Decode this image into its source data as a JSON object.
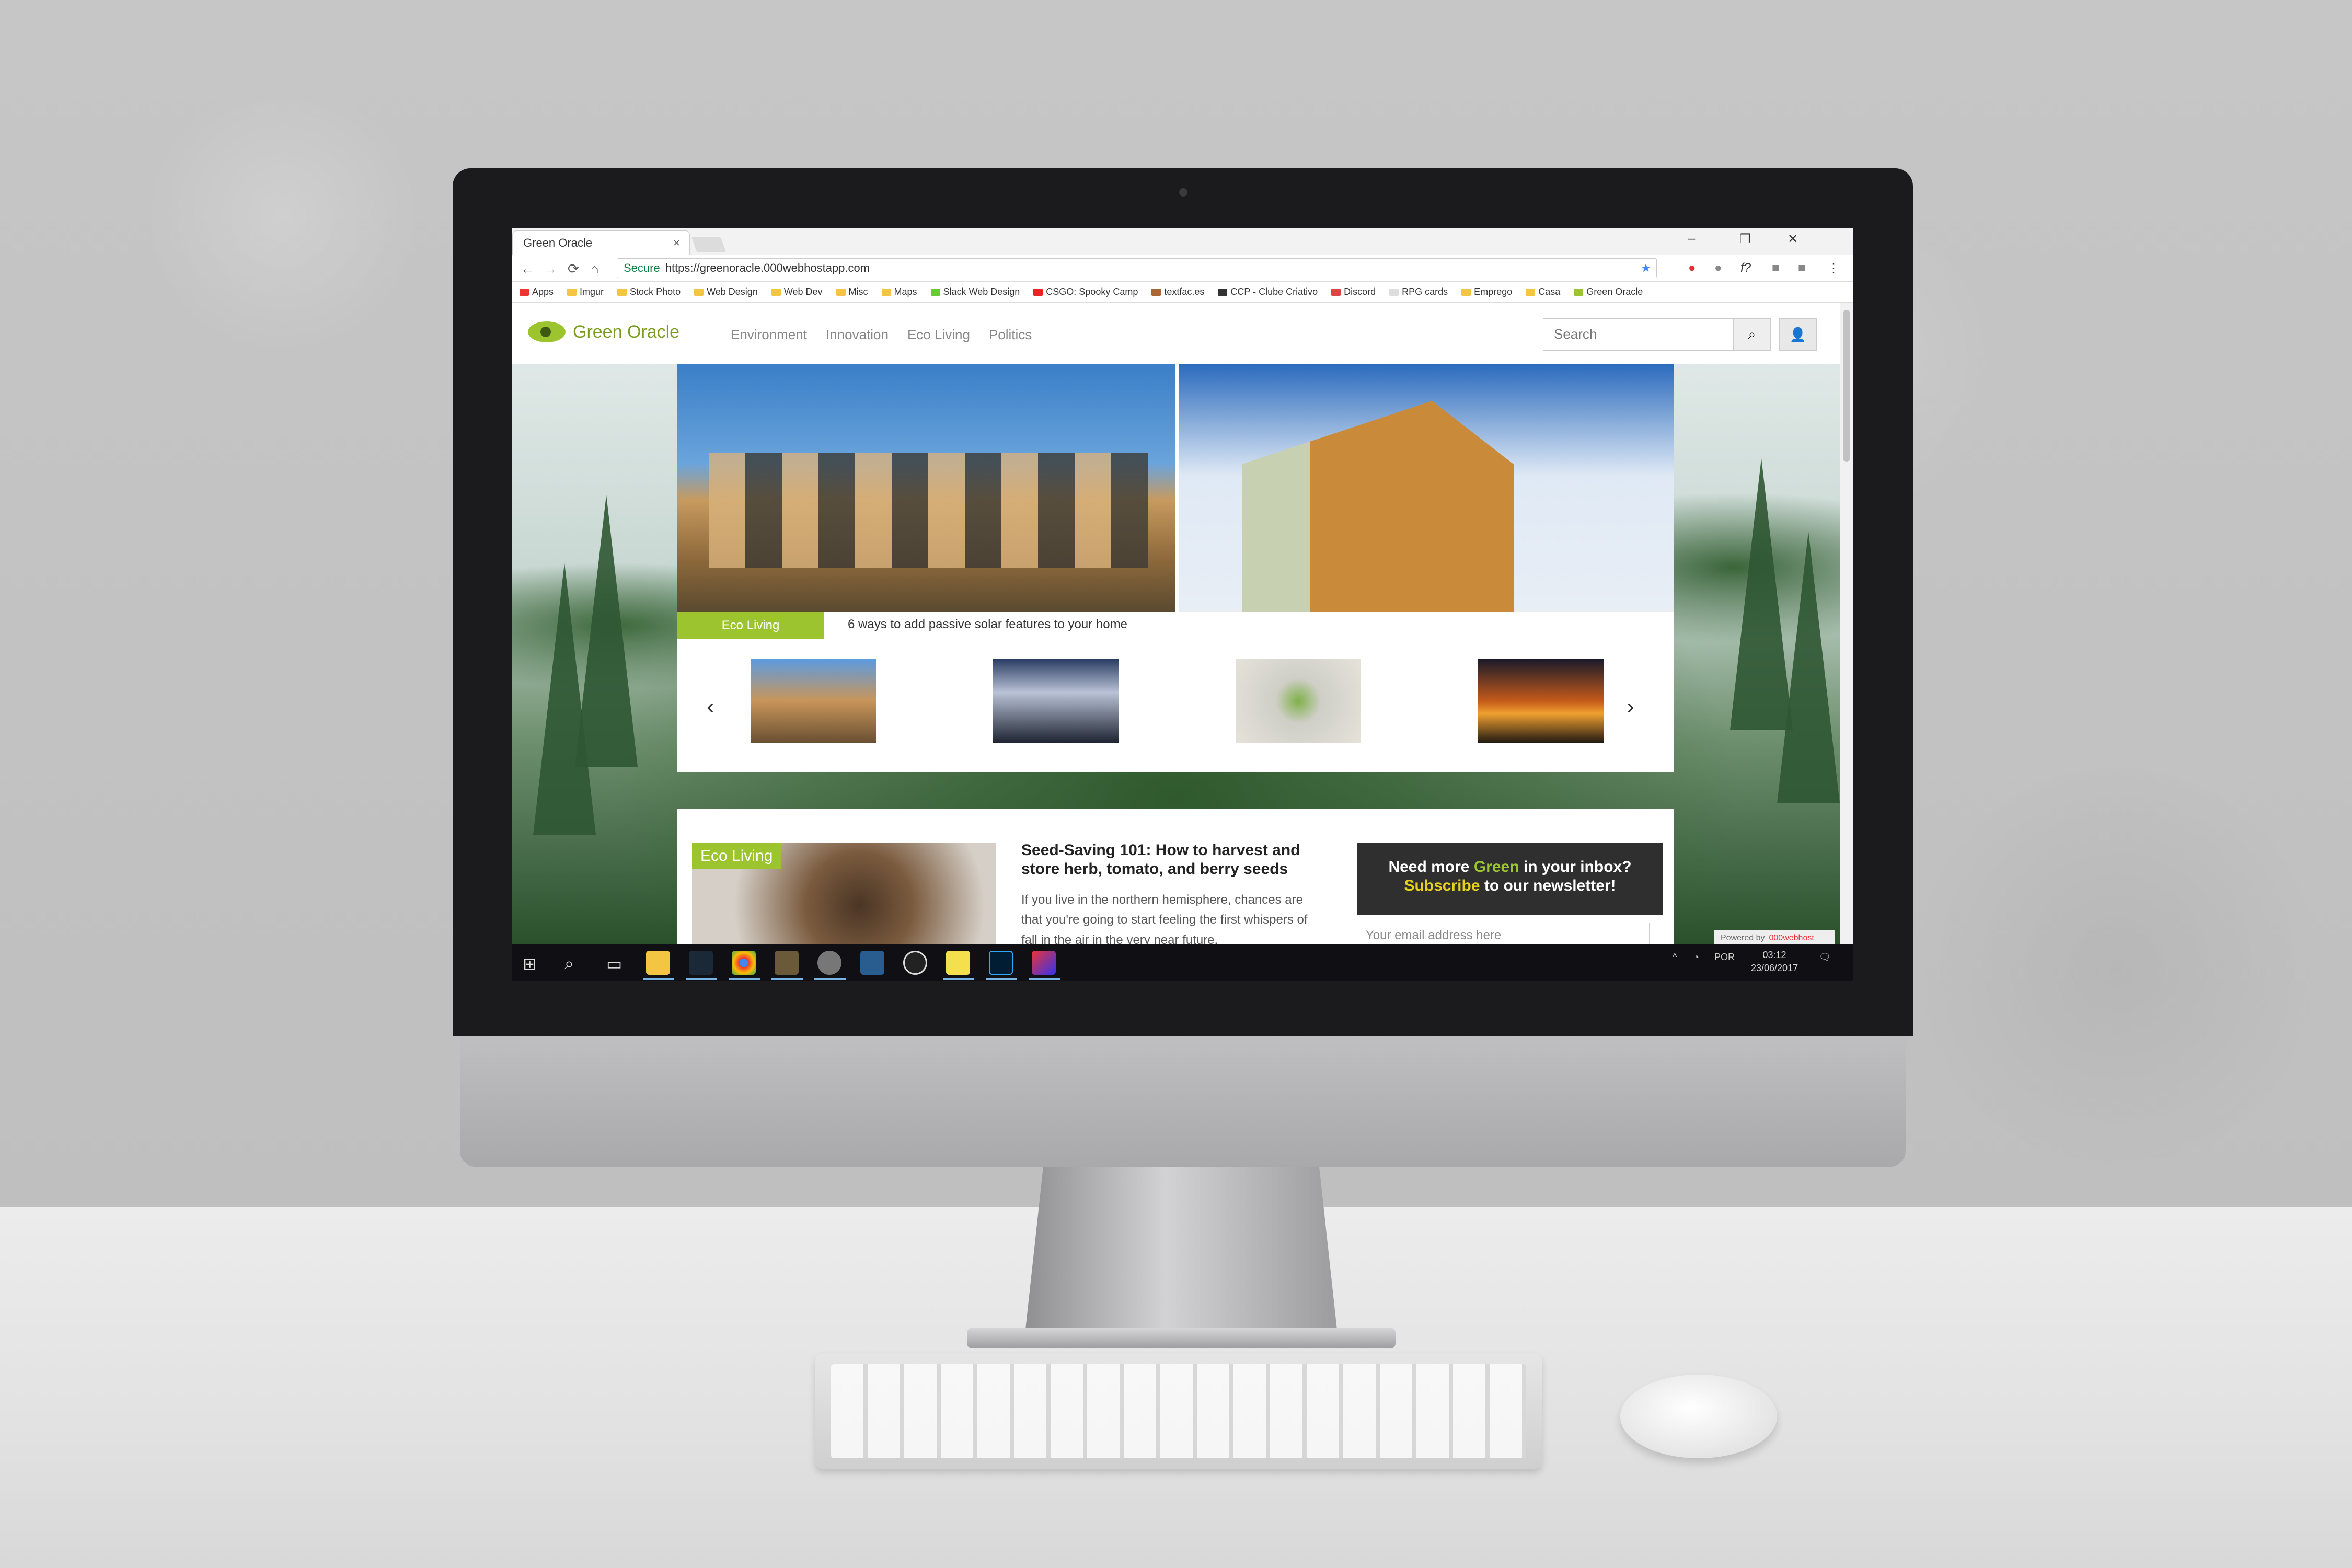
{
  "browser": {
    "tab_title": "Green Oracle",
    "tab_close_icon": "×",
    "minimize_icon": "–",
    "restore_icon": "❐",
    "close_icon": "✕",
    "back_icon": "←",
    "forward_icon": "→",
    "reload_icon": "⟳",
    "home_icon": "⌂",
    "secure_label": "Secure",
    "url": "https://greenoracle.000webhostapp.com",
    "star_icon": "★",
    "menu_icon": "⋮",
    "bookmarks": [
      {
        "label": "Apps"
      },
      {
        "label": "Imgur"
      },
      {
        "label": "Stock Photo"
      },
      {
        "label": "Web Design"
      },
      {
        "label": "Web Dev"
      },
      {
        "label": "Misc"
      },
      {
        "label": "Maps"
      },
      {
        "label": "Slack Web Design"
      },
      {
        "label": "CSGO: Spooky Camp"
      },
      {
        "label": "textfac.es"
      },
      {
        "label": "CCP - Clube Criativo"
      },
      {
        "label": "Discord"
      },
      {
        "label": "RPG cards"
      },
      {
        "label": "Emprego"
      },
      {
        "label": "Casa"
      },
      {
        "label": "Green Oracle"
      }
    ]
  },
  "site": {
    "logo_text": "Green Oracle",
    "nav": [
      "Environment",
      "Innovation",
      "Eco Living",
      "Politics"
    ],
    "search_placeholder": "Search",
    "search_icon": "⌕",
    "user_icon": "👤",
    "hero": {
      "category": "Eco Living",
      "caption": "6 ways to add passive solar features to your home",
      "prev_icon": "‹",
      "next_icon": "›"
    },
    "article": {
      "category": "Eco Living",
      "title": "Seed-Saving 101: How to harvest and store herb, tomato, and berry seeds",
      "excerpt": "If you live in the northern hemisphere, chances are that you're going to start feeling the first whispers of fall in the air in the very near future."
    },
    "newsletter": {
      "line1_a": "Need more ",
      "line1_green": "Green",
      "line1_b": " in your inbox?",
      "line2_yellow": "Subscribe",
      "line2_b": " to our newsletter!",
      "email_placeholder": "Your email address here"
    },
    "powered_by": "Powered by",
    "powered_brand": "000webhost"
  },
  "taskbar": {
    "start_icon": "⊞",
    "search_icon": "⌕",
    "task_view_icon": "▭",
    "language": "POR",
    "time": "03:12",
    "date": "23/06/2017",
    "notifications_icon": "🗨"
  }
}
